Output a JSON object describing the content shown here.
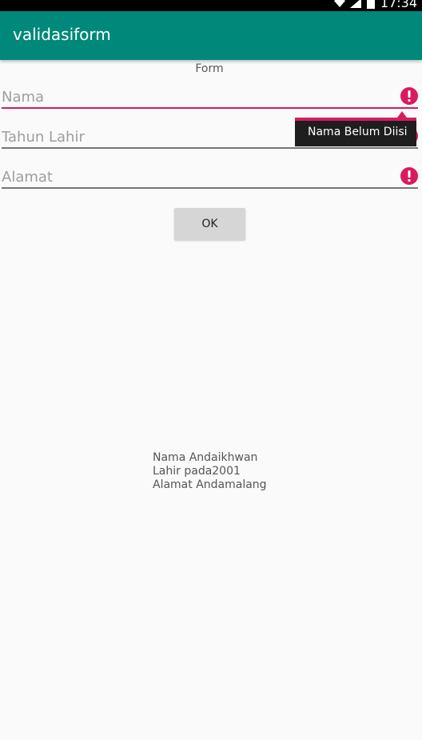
{
  "status_bar": {
    "time": "17:34",
    "icons": [
      "wifi-icon",
      "signal-icon",
      "battery-icon"
    ]
  },
  "app_bar": {
    "title": "validasiform",
    "color": "#00897b"
  },
  "form": {
    "label": "Form",
    "fields": [
      {
        "placeholder": "Nama",
        "value": ""
      },
      {
        "placeholder": "Tahun Lahir",
        "value": ""
      },
      {
        "placeholder": "Alamat",
        "value": ""
      }
    ],
    "error_tooltip": "Nama Belum Diisi",
    "error_color": "#d81b60",
    "submit_label": "OK"
  },
  "result": {
    "lines": [
      "Nama Andaikhwan",
      "Lahir pada2001",
      "Alamat Andamalang"
    ]
  }
}
